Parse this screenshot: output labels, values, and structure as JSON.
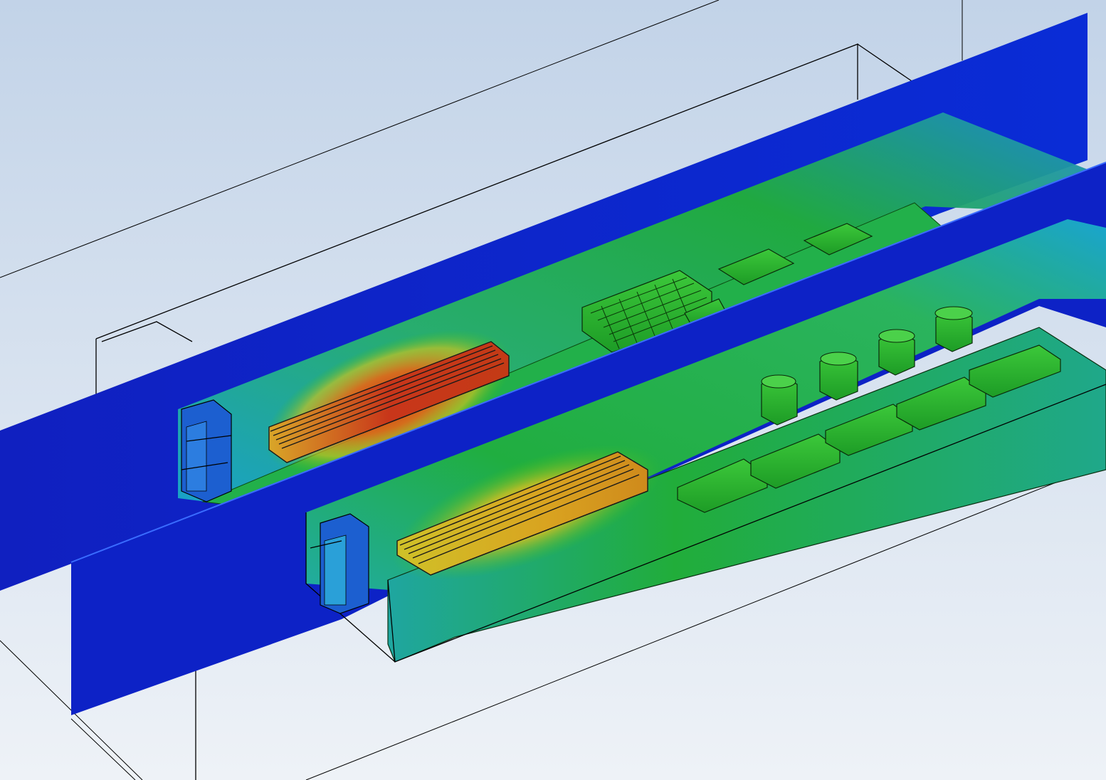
{
  "view": {
    "background_top": "#c2d3e8",
    "background_bottom": "#eef2f7",
    "edge_color": "#000000"
  },
  "legend": {
    "scale": [
      "#1b1fb0",
      "#0a44d8",
      "#1aa8c8",
      "#19b04a",
      "#3dc21a",
      "#b8c81a",
      "#e0a21a",
      "#d24a14",
      "#c0200c"
    ],
    "low_color": "#1b1fb0",
    "high_color": "#c0200c"
  },
  "models": [
    {
      "id": "module-upper",
      "heat_sink_color": "#c43a16",
      "fins": 6,
      "components": [
        "capacitor-grid",
        "ic-large",
        "ic-small"
      ]
    },
    {
      "id": "module-lower",
      "heat_sink_color": "#d9a320",
      "fins": 6,
      "components": [
        "inductor",
        "inductor",
        "inductor",
        "inductor",
        "chip",
        "chip",
        "chip",
        "chip",
        "chip"
      ]
    }
  ]
}
